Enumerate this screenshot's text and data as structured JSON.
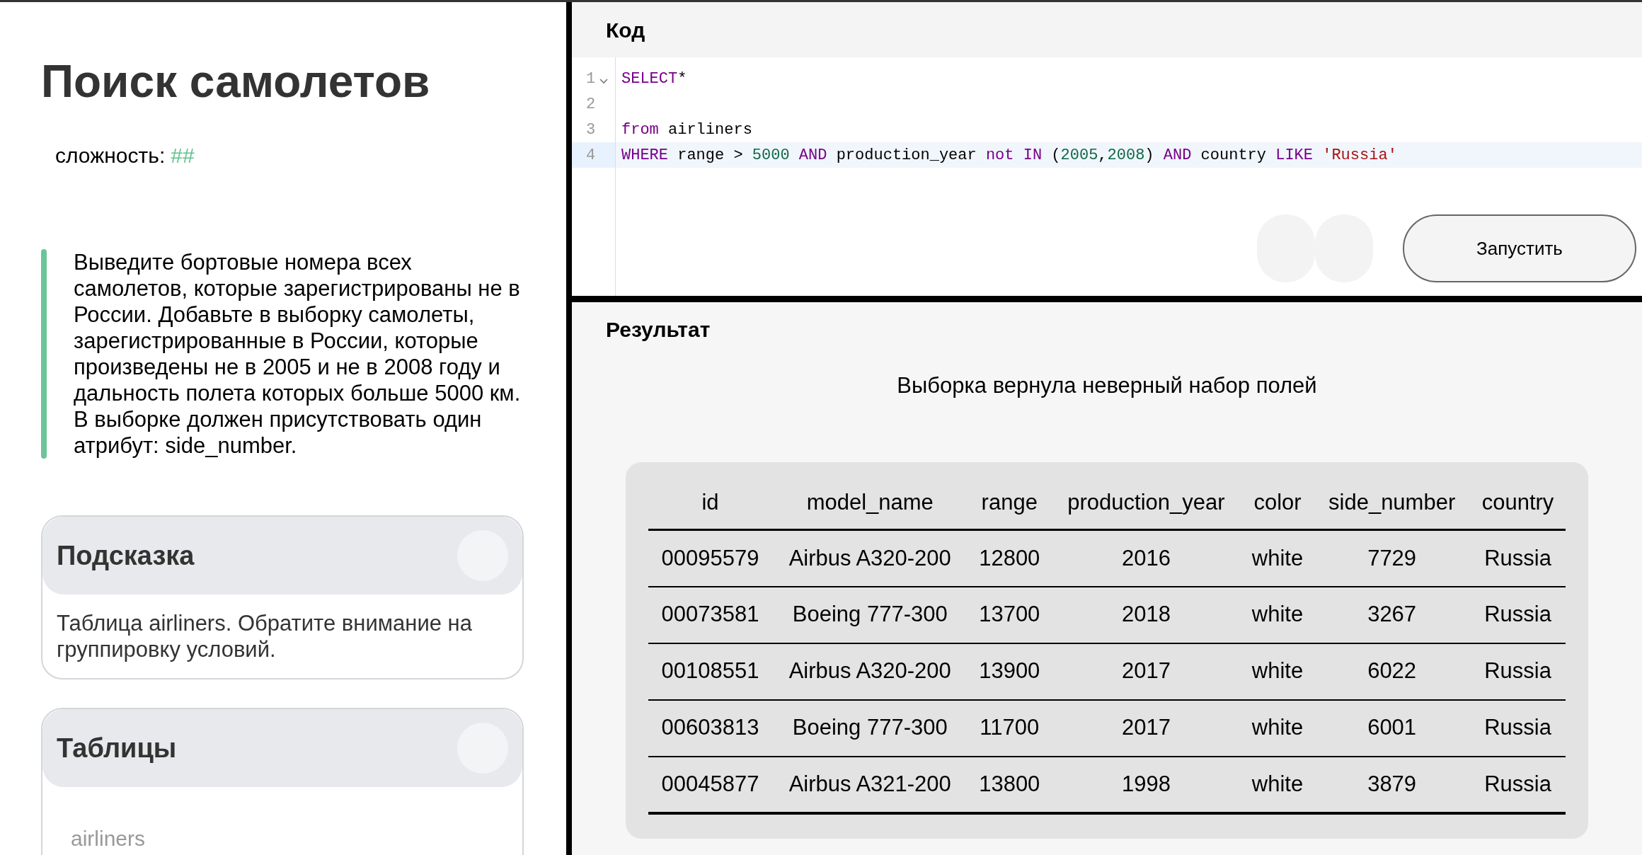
{
  "task": {
    "title": "Поиск самолетов",
    "difficulty_label": "сложность:",
    "difficulty_marks": "##",
    "description": "Выведите бортовые номера всех самолетов, которые зарегистрированы не в России. Добавьте в выборку самолеты, зарегистрированные в России, которые произведены не в 2005 и не в 2008 году и дальность полета которых больше 5000 км. В выборке должен присутствовать один атрибут: side_number."
  },
  "cards": [
    {
      "title": "Подсказка",
      "expanded": true,
      "kind": "text",
      "body": "Таблица airliners. Обратите внимание на группировку условий."
    },
    {
      "title": "Таблицы",
      "expanded": true,
      "kind": "list",
      "items": [
        "airliners"
      ]
    }
  ],
  "editor": {
    "title": "Код",
    "lines": [
      {
        "number": "1",
        "foldable": true,
        "active": false,
        "tokens": [
          {
            "kind": "keyword",
            "text": "SELECT"
          },
          {
            "kind": "plain",
            "text": "*"
          }
        ]
      },
      {
        "number": "2",
        "foldable": false,
        "active": false
      },
      {
        "number": "3",
        "foldable": false,
        "active": false,
        "tokens": [
          {
            "kind": "keyword",
            "text": "from"
          },
          {
            "kind": "plain",
            "text": " airliners"
          }
        ]
      },
      {
        "number": "4",
        "foldable": false,
        "active": true,
        "tokens": [
          {
            "kind": "keyword",
            "text": "WHERE"
          },
          {
            "kind": "plain",
            "text": " range > "
          },
          {
            "kind": "number",
            "text": "5000"
          },
          {
            "kind": "keyword",
            "text": " AND"
          },
          {
            "kind": "plain",
            "text": " production_year "
          },
          {
            "kind": "keyword",
            "text": "not IN"
          },
          {
            "kind": "plain",
            "text": " ("
          },
          {
            "kind": "number",
            "text": "2005"
          },
          {
            "kind": "plain",
            "text": ","
          },
          {
            "kind": "number",
            "text": "2008"
          },
          {
            "kind": "plain",
            "text": ") "
          },
          {
            "kind": "keyword",
            "text": "AND"
          },
          {
            "kind": "plain",
            "text": " country "
          },
          {
            "kind": "keyword",
            "text": "LIKE"
          },
          {
            "kind": "string",
            "text": " 'Russia'"
          }
        ]
      }
    ],
    "run_button": "Запустить"
  },
  "result": {
    "title": "Результат",
    "message": "Выборка вернула неверный набор полей",
    "table": {
      "columns": [
        "id",
        "model_name",
        "range",
        "production_year",
        "color",
        "side_number",
        "country"
      ],
      "rows": [
        [
          "00095579",
          "Airbus A320-200",
          "12800",
          "2016",
          "white",
          "7729",
          "Russia"
        ],
        [
          "00073581",
          "Boeing 777-300",
          "13700",
          "2018",
          "white",
          "3267",
          "Russia"
        ],
        [
          "00108551",
          "Airbus A320-200",
          "13900",
          "2017",
          "white",
          "6022",
          "Russia"
        ],
        [
          "00603813",
          "Boeing 777-300",
          "11700",
          "2017",
          "white",
          "6001",
          "Russia"
        ],
        [
          "00045877",
          "Airbus A321-200",
          "13800",
          "1998",
          "white",
          "3879",
          "Russia"
        ]
      ]
    }
  }
}
